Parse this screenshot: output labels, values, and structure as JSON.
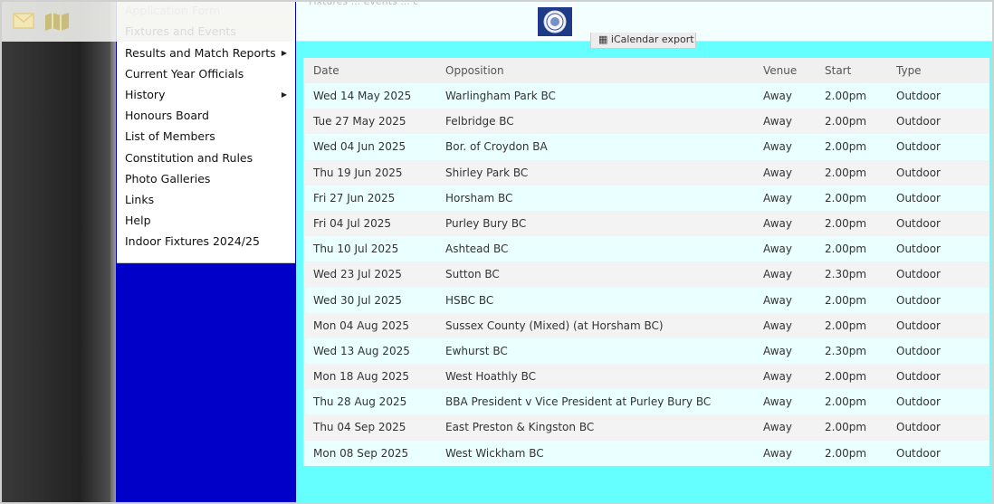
{
  "topbar": {
    "icons": [
      "envelope-icon",
      "map-icon"
    ]
  },
  "menu": {
    "items": [
      {
        "label": "Application Form",
        "submenu": false,
        "faded": true
      },
      {
        "label": "Fixtures and Events",
        "submenu": false,
        "faded": false
      },
      {
        "label": "Results and Match Reports",
        "submenu": true,
        "faded": false
      },
      {
        "label": "Current Year Officials",
        "submenu": false,
        "faded": false
      },
      {
        "label": "History",
        "submenu": true,
        "faded": false
      },
      {
        "label": "Honours Board",
        "submenu": false,
        "faded": false
      },
      {
        "label": "List of Members",
        "submenu": false,
        "faded": false
      },
      {
        "label": "Constitution and Rules",
        "submenu": false,
        "faded": false
      },
      {
        "label": "Photo Galleries",
        "submenu": false,
        "faded": false
      },
      {
        "label": "Links",
        "submenu": false,
        "faded": false
      },
      {
        "label": "Help",
        "submenu": false,
        "faded": false
      },
      {
        "label": "Indoor Fixtures 2024/25",
        "submenu": false,
        "faded": false
      }
    ],
    "arrow_glyph": "▶"
  },
  "header": {
    "faded_text": "Fixtures ... events ... c",
    "logo_icon": "club-crest-icon"
  },
  "export": {
    "label": "iCalendar export",
    "icon": "calendar-icon"
  },
  "table": {
    "columns": [
      "Date",
      "Opposition",
      "Venue",
      "Start",
      "Type"
    ],
    "rows": [
      [
        "Wed 14 May 2025",
        "Warlingham Park BC",
        "Away",
        "2.00pm",
        "Outdoor"
      ],
      [
        "Tue 27 May 2025",
        "Felbridge BC",
        "Away",
        "2.00pm",
        "Outdoor"
      ],
      [
        "Wed 04 Jun 2025",
        "Bor. of Croydon BA",
        "Away",
        "2.00pm",
        "Outdoor"
      ],
      [
        "Thu 19 Jun 2025",
        "Shirley Park BC",
        "Away",
        "2.00pm",
        "Outdoor"
      ],
      [
        "Fri 27 Jun 2025",
        "Horsham BC",
        "Away",
        "2.00pm",
        "Outdoor"
      ],
      [
        "Fri 04 Jul 2025",
        "Purley Bury BC",
        "Away",
        "2.00pm",
        "Outdoor"
      ],
      [
        "Thu 10 Jul 2025",
        "Ashtead BC",
        "Away",
        "2.00pm",
        "Outdoor"
      ],
      [
        "Wed 23 Jul 2025",
        "Sutton BC",
        "Away",
        "2.30pm",
        "Outdoor"
      ],
      [
        "Wed 30 Jul 2025",
        "HSBC BC",
        "Away",
        "2.00pm",
        "Outdoor"
      ],
      [
        "Mon 04 Aug 2025",
        "Sussex County (Mixed) (at Horsham BC)",
        "Away",
        "2.00pm",
        "Outdoor"
      ],
      [
        "Wed 13 Aug 2025",
        "Ewhurst BC",
        "Away",
        "2.30pm",
        "Outdoor"
      ],
      [
        "Mon 18 Aug 2025",
        "West Hoathly BC",
        "Away",
        "2.00pm",
        "Outdoor"
      ],
      [
        "Thu 28 Aug 2025",
        "BBA President v Vice President at Purley Bury BC",
        "Away",
        "2.00pm",
        "Outdoor"
      ],
      [
        "Thu 04 Sep 2025",
        "East Preston & Kingston BC",
        "Away",
        "2.00pm",
        "Outdoor"
      ],
      [
        "Mon 08 Sep 2025",
        "West Wickham BC",
        "Away",
        "2.00pm",
        "Outdoor"
      ]
    ]
  },
  "colors": {
    "main_bg": "#66ffff",
    "menu_column_bg": "#0000c8",
    "logo_bg": "#1e3b8a"
  }
}
